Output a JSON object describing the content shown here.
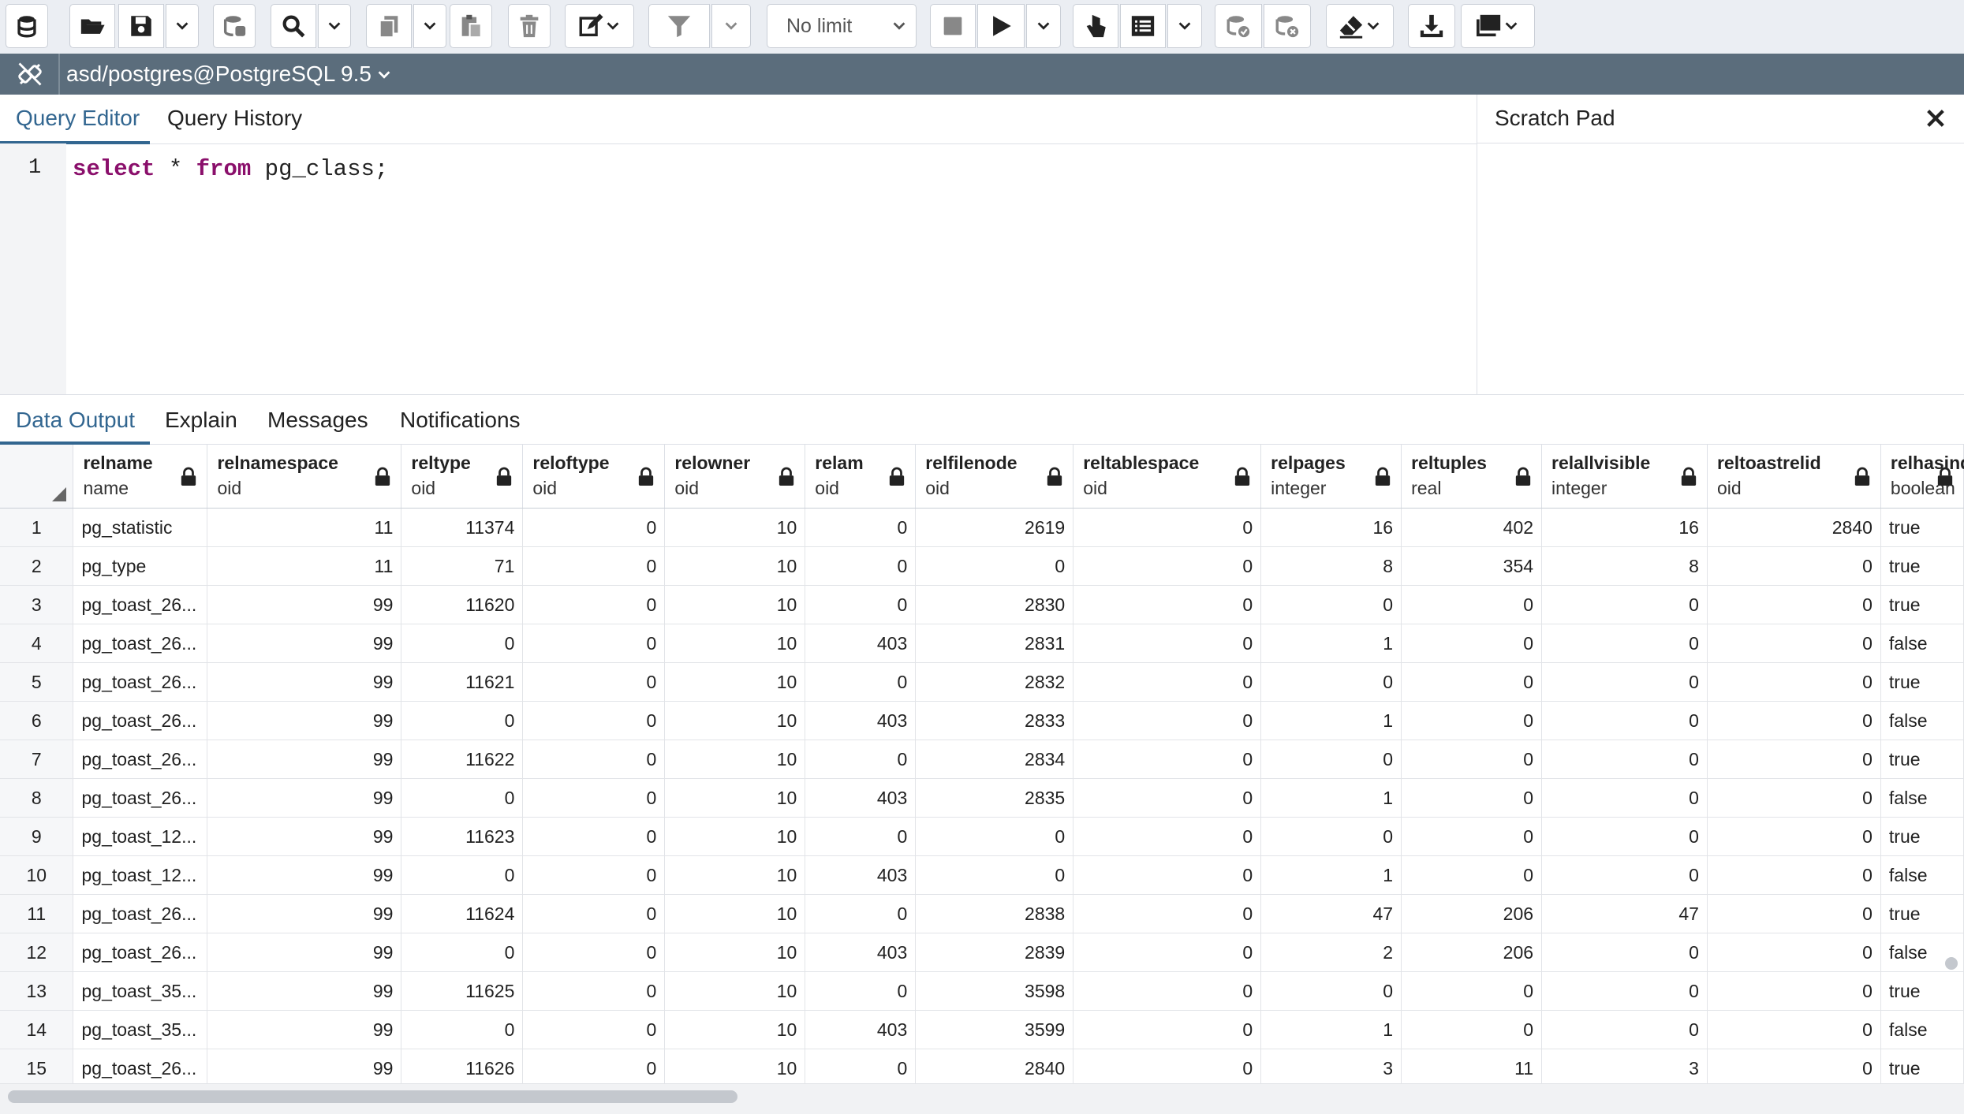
{
  "toolbar": {
    "limit_select": "No limit",
    "icons": [
      "database-icon",
      "folder-open-icon",
      "save-icon",
      "save-options-icon",
      "db-connection-icon",
      "search-icon",
      "search-options-icon",
      "copy-icon",
      "copy-options-icon",
      "paste-icon",
      "delete-icon",
      "edit-icon",
      "filter-icon",
      "filter-options-icon",
      "stop-icon",
      "execute-icon",
      "execute-options-icon",
      "explain-icon",
      "explain-analyze-icon",
      "explain-options-icon",
      "commit-icon",
      "rollback-icon",
      "clear-icon",
      "download-icon",
      "macros-icon"
    ]
  },
  "connection": {
    "label": "asd/postgres@PostgreSQL 9.5"
  },
  "editor": {
    "tabs": [
      "Query Editor",
      "Query History"
    ],
    "line_numbers": [
      "1"
    ],
    "code": {
      "kw1": "select",
      "t1": " * ",
      "kw2": "from",
      "t2": " pg_class;"
    }
  },
  "scratch_pad": {
    "title": "Scratch Pad"
  },
  "output_tabs": [
    "Data Output",
    "Explain",
    "Messages",
    "Notifications"
  ],
  "grid": {
    "columns": [
      {
        "name": "relname",
        "type": "name",
        "align": "left"
      },
      {
        "name": "relnamespace",
        "type": "oid",
        "align": "right"
      },
      {
        "name": "reltype",
        "type": "oid",
        "align": "right"
      },
      {
        "name": "reloftype",
        "type": "oid",
        "align": "right"
      },
      {
        "name": "relowner",
        "type": "oid",
        "align": "right"
      },
      {
        "name": "relam",
        "type": "oid",
        "align": "right"
      },
      {
        "name": "relfilenode",
        "type": "oid",
        "align": "right"
      },
      {
        "name": "reltablespace",
        "type": "oid",
        "align": "right"
      },
      {
        "name": "relpages",
        "type": "integer",
        "align": "right"
      },
      {
        "name": "reltuples",
        "type": "real",
        "align": "right"
      },
      {
        "name": "relallvisible",
        "type": "integer",
        "align": "right"
      },
      {
        "name": "reltoastrelid",
        "type": "oid",
        "align": "right"
      },
      {
        "name": "relhasind",
        "type": "boolean",
        "align": "left"
      }
    ],
    "rows": [
      [
        "1",
        "pg_statistic",
        "11",
        "11374",
        "0",
        "10",
        "0",
        "2619",
        "0",
        "16",
        "402",
        "16",
        "2840",
        "true"
      ],
      [
        "2",
        "pg_type",
        "11",
        "71",
        "0",
        "10",
        "0",
        "0",
        "0",
        "8",
        "354",
        "8",
        "0",
        "true"
      ],
      [
        "3",
        "pg_toast_26...",
        "99",
        "11620",
        "0",
        "10",
        "0",
        "2830",
        "0",
        "0",
        "0",
        "0",
        "0",
        "true"
      ],
      [
        "4",
        "pg_toast_26...",
        "99",
        "0",
        "0",
        "10",
        "403",
        "2831",
        "0",
        "1",
        "0",
        "0",
        "0",
        "false"
      ],
      [
        "5",
        "pg_toast_26...",
        "99",
        "11621",
        "0",
        "10",
        "0",
        "2832",
        "0",
        "0",
        "0",
        "0",
        "0",
        "true"
      ],
      [
        "6",
        "pg_toast_26...",
        "99",
        "0",
        "0",
        "10",
        "403",
        "2833",
        "0",
        "1",
        "0",
        "0",
        "0",
        "false"
      ],
      [
        "7",
        "pg_toast_26...",
        "99",
        "11622",
        "0",
        "10",
        "0",
        "2834",
        "0",
        "0",
        "0",
        "0",
        "0",
        "true"
      ],
      [
        "8",
        "pg_toast_26...",
        "99",
        "0",
        "0",
        "10",
        "403",
        "2835",
        "0",
        "1",
        "0",
        "0",
        "0",
        "false"
      ],
      [
        "9",
        "pg_toast_12...",
        "99",
        "11623",
        "0",
        "10",
        "0",
        "0",
        "0",
        "0",
        "0",
        "0",
        "0",
        "true"
      ],
      [
        "10",
        "pg_toast_12...",
        "99",
        "0",
        "0",
        "10",
        "403",
        "0",
        "0",
        "1",
        "0",
        "0",
        "0",
        "false"
      ],
      [
        "11",
        "pg_toast_26...",
        "99",
        "11624",
        "0",
        "10",
        "0",
        "2838",
        "0",
        "47",
        "206",
        "47",
        "0",
        "true"
      ],
      [
        "12",
        "pg_toast_26...",
        "99",
        "0",
        "0",
        "10",
        "403",
        "2839",
        "0",
        "2",
        "206",
        "0",
        "0",
        "false"
      ],
      [
        "13",
        "pg_toast_35...",
        "99",
        "11625",
        "0",
        "10",
        "0",
        "3598",
        "0",
        "0",
        "0",
        "0",
        "0",
        "true"
      ],
      [
        "14",
        "pg_toast_35...",
        "99",
        "0",
        "0",
        "10",
        "403",
        "3599",
        "0",
        "1",
        "0",
        "0",
        "0",
        "false"
      ],
      [
        "15",
        "pg_toast_26...",
        "99",
        "11626",
        "0",
        "10",
        "0",
        "2840",
        "0",
        "3",
        "11",
        "3",
        "0",
        "true"
      ]
    ]
  }
}
